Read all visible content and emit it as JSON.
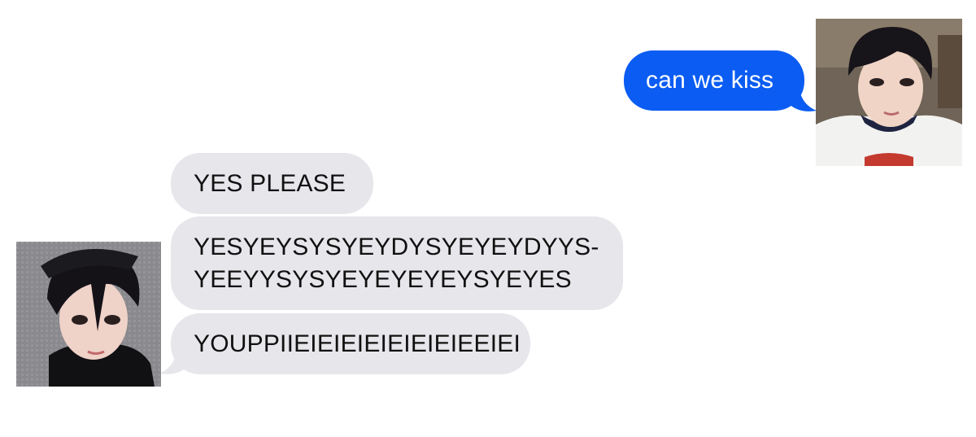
{
  "conversation": {
    "sent_messages": [
      {
        "text": "can we kiss"
      }
    ],
    "received_messages": [
      {
        "text": "YES PLEASE"
      },
      {
        "line1": "YESYEYSYSYEYDYSYEYEYDYYS-",
        "line2": "YEEYYSYSYEYEYEYEYSYEYES"
      },
      {
        "text": "YOUPPIIEIEIEIEIEIEIEIEEIEI"
      }
    ]
  },
  "colors": {
    "sent_bubble": "#0a5cf2",
    "received_bubble": "#e6e6eb",
    "background": "#ffffff"
  },
  "icons": {
    "sender_avatar": "avatar-photo-icon",
    "receiver_avatar": "avatar-photo-icon"
  }
}
